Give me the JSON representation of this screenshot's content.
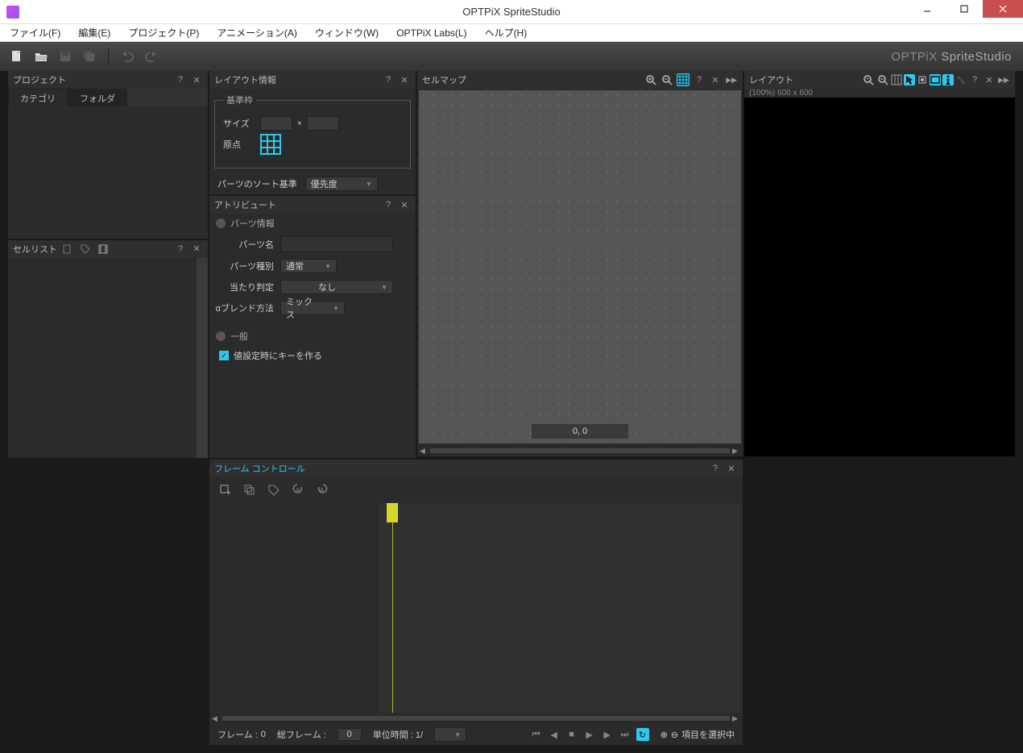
{
  "window": {
    "title": "OPTPiX SpriteStudio"
  },
  "menu": {
    "file": "ファイル(F)",
    "edit": "編集(E)",
    "project": "プロジェクト(P)",
    "animation": "アニメーション(A)",
    "window": "ウィンドウ(W)",
    "labs": "OPTPiX Labs(L)",
    "help": "ヘルプ(H)"
  },
  "toolbar": {
    "brand_prefix": "OPTPiX",
    "brand": "SpriteStudio"
  },
  "panels": {
    "project": {
      "title": "プロジェクト",
      "tab_category": "カテゴリ",
      "tab_folder": "フォルダ"
    },
    "celllist": {
      "title": "セルリスト"
    },
    "cellmap": {
      "title": "セルマップ",
      "coords": "0, 0"
    },
    "layout": {
      "title": "レイアウト",
      "zoom_info": "(100%) 600 x 600"
    },
    "frame": {
      "title": "フレーム コントロール",
      "frame_label": "フレーム :",
      "frame_value": "0",
      "total_label": "総フレーム :",
      "total_value": "0",
      "unit_label": "単位時間 : 1/",
      "status": "項目を選択中"
    },
    "layoutinfo": {
      "title": "レイアウト情報",
      "legend": "基準枠",
      "size_label": "サイズ",
      "origin_label": "原点",
      "sort_label": "パーツのソート基準",
      "sort_value": "優先度"
    },
    "attribute": {
      "title": "アトリビュート",
      "parts_info": "パーツ情報",
      "parts_name_label": "パーツ名",
      "parts_type_label": "パーツ種別",
      "parts_type_value": "通常",
      "hit_label": "当たり判定",
      "hit_value": "なし",
      "blend_label": "αブレンド方法",
      "blend_value": "ミックス",
      "general": "一般",
      "key_on_set": "値設定時にキーを作る"
    }
  }
}
